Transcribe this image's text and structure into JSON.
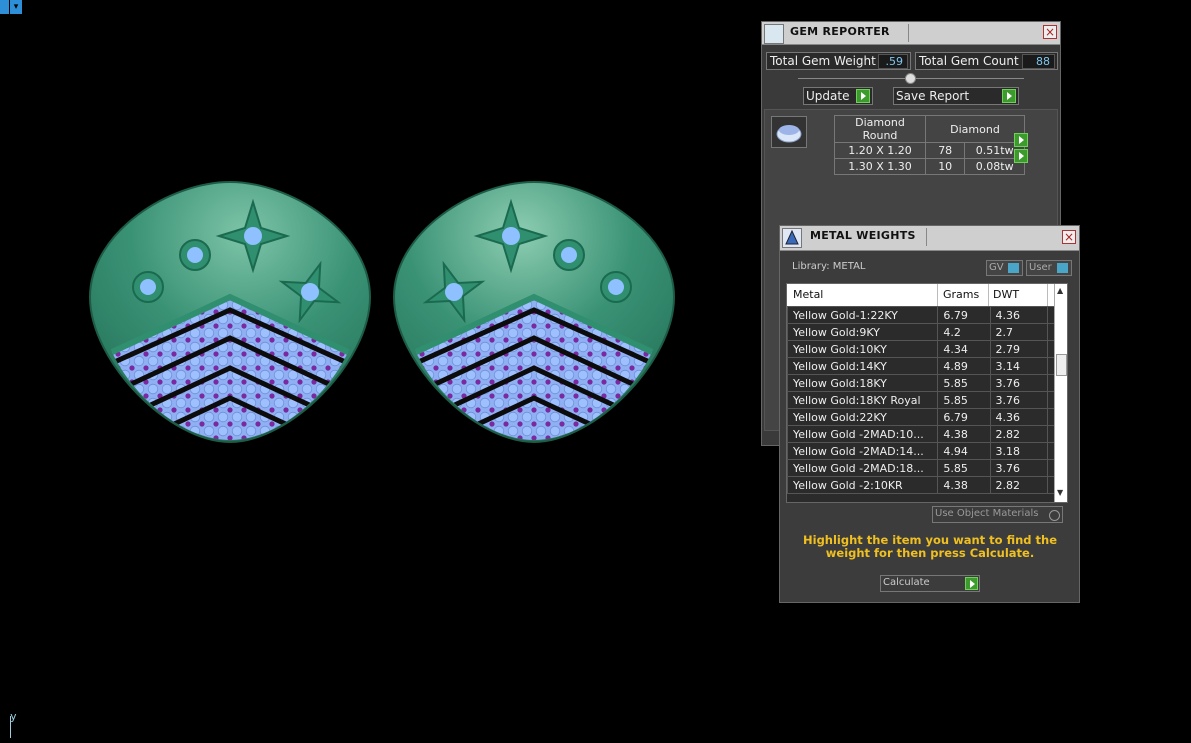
{
  "gem_reporter": {
    "title": "GEM REPORTER",
    "total_weight_label": "Total Gem Weight",
    "total_weight_value": ".59",
    "total_count_label": "Total Gem Count",
    "total_count_value": "88",
    "update_label": "Update",
    "save_label": "Save Report",
    "table_header": {
      "shape": "Diamond Round",
      "material": "Diamond"
    },
    "rows": [
      {
        "size": "1.20 X 1.20",
        "count": "78",
        "weight": "0.51tw"
      },
      {
        "size": "1.30 X 1.30",
        "count": "10",
        "weight": "0.08tw"
      }
    ]
  },
  "metal_weights": {
    "title": "METAL WEIGHTS",
    "library_label": "Library: METAL",
    "gv_label": "GV",
    "user_label": "User",
    "columns": [
      "Metal",
      "Grams",
      "DWT"
    ],
    "rows": [
      {
        "metal": "Yellow Gold-1:22KY",
        "grams": "6.79",
        "dwt": "4.36"
      },
      {
        "metal": "Yellow Gold:9KY",
        "grams": "4.2",
        "dwt": "2.7"
      },
      {
        "metal": "Yellow Gold:10KY",
        "grams": "4.34",
        "dwt": "2.79"
      },
      {
        "metal": "Yellow Gold:14KY",
        "grams": "4.89",
        "dwt": "3.14"
      },
      {
        "metal": "Yellow Gold:18KY",
        "grams": "5.85",
        "dwt": "3.76"
      },
      {
        "metal": "Yellow Gold:18KY Royal",
        "grams": "5.85",
        "dwt": "3.76"
      },
      {
        "metal": "Yellow Gold:22KY",
        "grams": "6.79",
        "dwt": "4.36"
      },
      {
        "metal": "Yellow Gold -2MAD:10...",
        "grams": "4.38",
        "dwt": "2.82"
      },
      {
        "metal": "Yellow Gold -2MAD:14...",
        "grams": "4.94",
        "dwt": "3.18"
      },
      {
        "metal": "Yellow Gold -2MAD:18...",
        "grams": "5.85",
        "dwt": "3.76"
      },
      {
        "metal": "Yellow Gold -2:10KR",
        "grams": "4.38",
        "dwt": "2.82"
      }
    ],
    "use_object_materials": "Use Object Materials",
    "instruction": "Highlight the item you want to find the weight for then press Calculate.",
    "calculate_label": "Calculate"
  },
  "viewport": {
    "axis_label": "y"
  },
  "colors": {
    "metal_green": "#2f8f6f",
    "gem_blue": "#8ab4f0",
    "gem_purple": "#7a2aa0",
    "accent_yellow": "#f0c020",
    "go_green": "#3d9a2d"
  }
}
